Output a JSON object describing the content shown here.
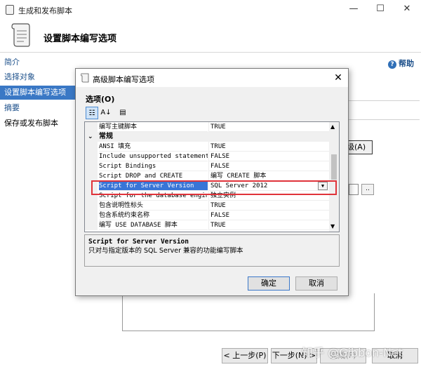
{
  "window": {
    "title": "生成和发布脚本",
    "controls": {
      "minimize": "—",
      "maximize": "☐",
      "close": "✕"
    }
  },
  "header": {
    "title": "设置脚本编写选项"
  },
  "help": {
    "label": "帮助"
  },
  "sidebar": {
    "items": [
      {
        "label": "简介"
      },
      {
        "label": "选择对象"
      },
      {
        "label": "设置脚本编写选项"
      },
      {
        "label": "摘要"
      },
      {
        "label": "保存或发布脚本"
      }
    ]
  },
  "background": {
    "advanced_button": "级(A)",
    "ellipsis": ".."
  },
  "footer": {
    "prev": "< 上一步(P)",
    "next": "下一步(N) >",
    "finish": "完成(F)",
    "cancel": "取消"
  },
  "watermark": "知乎 @Gibbon-Net",
  "dialog": {
    "title": "高级脚本编写选项",
    "close": "✕",
    "options_label": "选项(O)",
    "toolbar": {
      "categorized": "☷",
      "alphabetical": "A↓",
      "pages": "▤"
    },
    "rows": [
      {
        "name": "编写主键脚本",
        "value": "TRUE"
      },
      {
        "name": "常规",
        "value": "",
        "category": true
      },
      {
        "name": "ANSI 填充",
        "value": "TRUE"
      },
      {
        "name": "Include unsupported statements",
        "value": "FALSE"
      },
      {
        "name": "Script Bindings",
        "value": "FALSE"
      },
      {
        "name": "Script DROP and CREATE",
        "value": "编写 CREATE 脚本"
      },
      {
        "name": "Script for Server Version",
        "value": "SQL Server 2012",
        "selected": true
      },
      {
        "name": "Script for the database engine",
        "value": "独立实例"
      },
      {
        "name": "包含说明性标头",
        "value": "TRUE"
      },
      {
        "name": "包含系统约束名称",
        "value": "FALSE"
      },
      {
        "name": "编写 USE DATABASE 脚本",
        "value": "TRUE"
      }
    ],
    "description": {
      "title": "Script for Server Version",
      "text": "只对与指定版本的 SQL Server 兼容的功能编写脚本"
    },
    "ok": "确定",
    "cancel": "取消"
  },
  "colors": {
    "selection": "#3875d7",
    "nav_selected": "#3a78c5",
    "highlight_border": "#e0333a"
  }
}
